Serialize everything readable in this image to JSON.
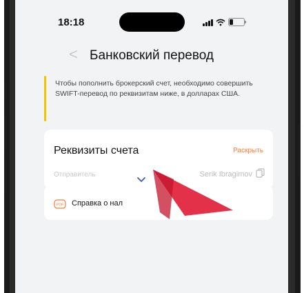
{
  "status_bar": {
    "time": "18:18"
  },
  "nav": {
    "back_glyph": "<",
    "title": "Банковский перевод"
  },
  "info": {
    "text": "Чтобы пополнить брокерский счет, необходимо совершить SWIFT-перевод по реквизитам ниже, в долларах США."
  },
  "accounts": {
    "title": "Реквизиты счета",
    "expand_label": "Раскрыть",
    "rows": [
      {
        "label": "Отправитель",
        "value": "Serik Ibragimov"
      }
    ]
  },
  "help": {
    "label": "Справка о нал"
  },
  "colors": {
    "accent": "#ff7a33",
    "info_bar": "#f2c200",
    "annotation_arrow": "#e0203a"
  },
  "icons": [
    "back-chevron-icon",
    "signal-icon",
    "wifi-icon",
    "battery-icon",
    "copy-icon",
    "chevron-down-icon",
    "pdf-icon",
    "annotation-arrow-icon"
  ]
}
